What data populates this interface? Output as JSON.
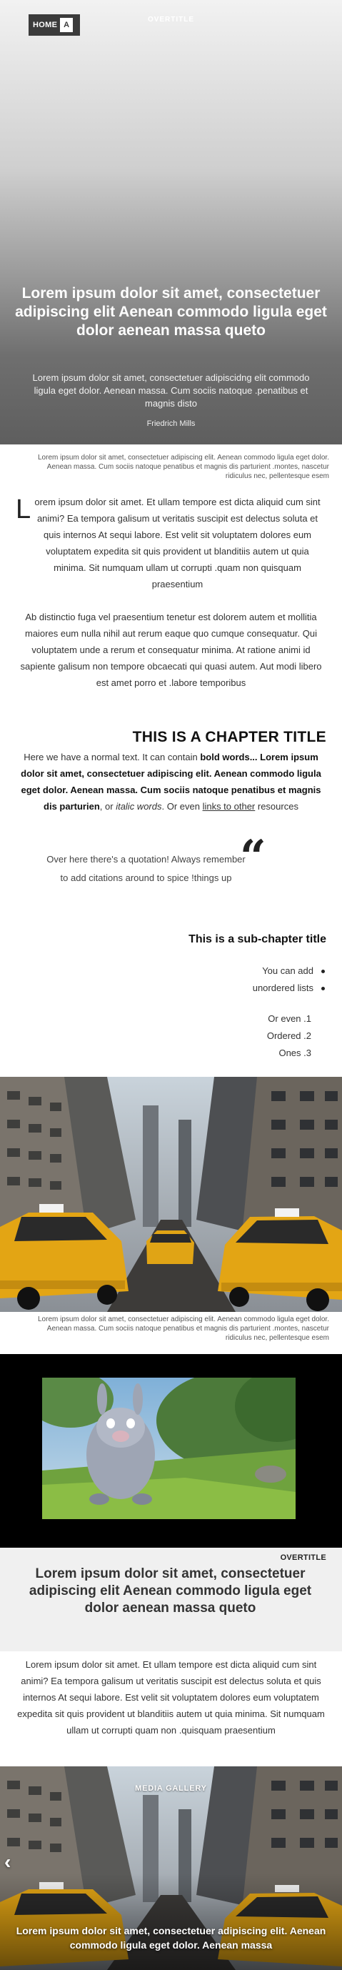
{
  "header": {
    "home_label": "HOME",
    "logo_text": "A",
    "overtitle": "OVERTITLE"
  },
  "hero": {
    "title": "Lorem ipsum dolor sit amet, consectetuer adipiscing elit Aenean commodo ligula eget dolor aenean massa queto",
    "subtitle": "Lorem ipsum dolor sit amet, consectetuer adipiscidng elit commodo ligula eget dolor. Aenean massa. Cum sociis natoque .penatibus et magnis disto",
    "author": "Friedrich Mills"
  },
  "caption_1": "Lorem ipsum dolor sit amet, consectetuer adipiscing elit. Aenean commodo ligula eget dolor. Aenean massa. Cum sociis natoque penatibus et magnis dis parturient .montes, nascetur ridiculus nec, pellentesque esem",
  "article": {
    "dropcap": "L",
    "para_1": "orem ipsum dolor sit amet. Et ullam tempore est dicta aliquid cum sint animi? Ea tempora galisum ut veritatis suscipit est delectus soluta et quis internos At sequi labore. Est velit sit voluptatem dolores eum voluptatem expedita sit quis provident ut blanditiis autem ut quia minima. Sit numquam ullam ut corrupti .quam non quisquam praesentium",
    "para_2": "Ab distinctio fuga vel praesentium tenetur est dolorem autem et mollitia maiores eum nulla nihil aut rerum eaque quo cumque consequatur. Qui voluptatem unde a rerum et consequatur minima. At ratione animi id sapiente galisum non tempore obcaecati qui quasi autem. Aut modi libero est amet porro et .labore temporibus",
    "chapter_title": "THIS IS A CHAPTER TITLE",
    "para_3_pre": "Here we have a normal text. It can contain ",
    "para_3_bold": "bold words... Lorem ipsum dolor sit amet, consectetuer adipiscing elit. Aenean commodo ligula eget dolor. Aenean massa. Cum sociis natoque penatibus et magnis dis parturien",
    "para_3_mid": ", or ",
    "para_3_italic": "italic words",
    "para_3_mid2": ". Or even ",
    "para_3_link": "links to other",
    "para_3_post": " resources",
    "quote": "Over here there's a quotation! Always remember to add citations around to spice !things up",
    "sub_title": "This is a sub-chapter title",
    "ul_items": [
      "You can add",
      "unordered lists"
    ],
    "ol_items": [
      "Or even .1",
      "Ordered .2",
      "Ones .3"
    ]
  },
  "caption_2": "Lorem ipsum dolor sit amet, consectetuer adipiscing elit. Aenean commodo ligula eget dolor. Aenean massa. Cum sociis natoque penatibus et magnis dis parturient .montes, nascetur ridiculus nec, pellentesque esem",
  "highlight": {
    "overtitle": "OVERTITLE",
    "title": "Lorem ipsum dolor sit amet, consectetuer adipiscing elit Aenean commodo ligula eget dolor aenean massa queto"
  },
  "para_4": "Lorem ipsum dolor sit amet. Et ullam tempore est dicta aliquid cum sint animi? Ea tempora galisum ut veritatis suscipit est delectus soluta et quis internos At sequi labore. Est velit sit voluptatem dolores eum voluptatem expedita sit quis provident ut blanditiis autem ut quia minima. Sit numquam ullam ut corrupti quam non .quisquam praesentium",
  "gallery": {
    "label": "MEDIA GALLERY",
    "arrow_icon": "chevron-left-icon",
    "caption": "Lorem ipsum dolor sit amet, consectetuer adipiscing elit. Aenean commodo ligula eget dolor. Aenean massa"
  }
}
